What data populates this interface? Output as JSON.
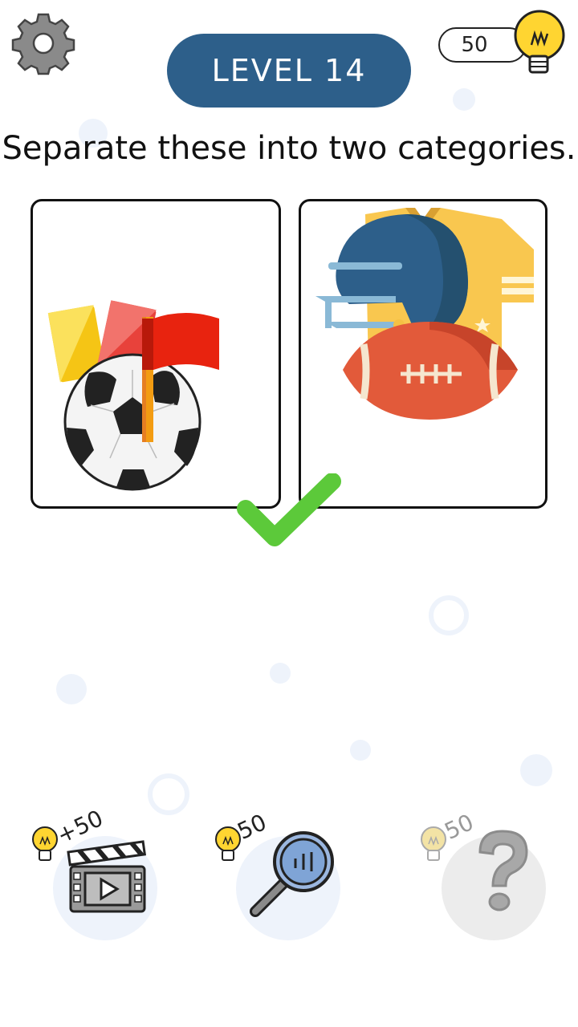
{
  "header": {
    "level_label": "LEVEL 14",
    "hint_count": "50"
  },
  "instruction": "Separate these into two categories.",
  "panels": [
    {
      "category": "soccer",
      "items": [
        "yellow-card",
        "red-card",
        "corner-flag",
        "soccer-ball"
      ]
    },
    {
      "category": "american-football",
      "items": [
        "football-helmet",
        "jersey",
        "american-football-ball"
      ]
    }
  ],
  "result": {
    "state": "correct",
    "icon": "checkmark-icon"
  },
  "tools": [
    {
      "name": "watch-video",
      "cost_label": "+50",
      "icon": "clapperboard-icon"
    },
    {
      "name": "magnifier",
      "cost_label": "50",
      "icon": "magnifier-icon"
    },
    {
      "name": "hint",
      "cost_label": "50",
      "icon": "question-mark-icon"
    }
  ],
  "colors": {
    "banner": "#2d5f8a",
    "check": "#5cc93a",
    "bulb": "#ffd531",
    "bubble": "#eef3fb"
  }
}
